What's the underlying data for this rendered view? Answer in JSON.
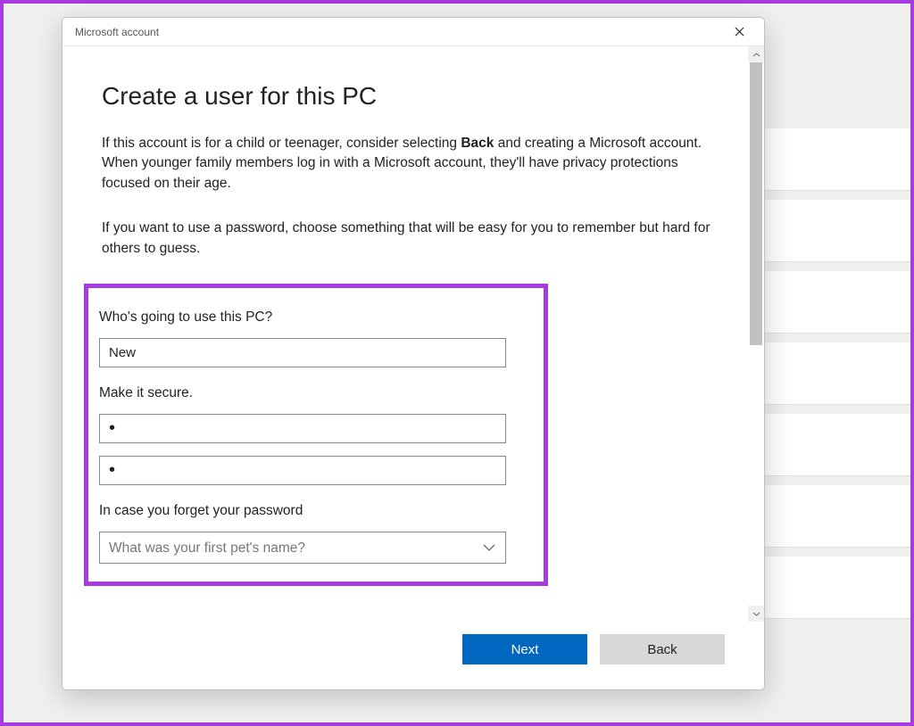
{
  "window": {
    "title": "Microsoft account"
  },
  "page": {
    "heading": "Create a user for this PC",
    "para1_pre": "If this account is for a child or teenager, consider selecting ",
    "para1_bold": "Back",
    "para1_post": " and creating a Microsoft account. When younger family members log in with a Microsoft account, they'll have privacy protections focused on their age.",
    "para2": "If you want to use a password, choose something that will be easy for you to remember but hard for others to guess."
  },
  "form": {
    "who_label": "Who's going to use this PC?",
    "username_value": "New",
    "secure_label": "Make it secure.",
    "password_value": "•",
    "password_confirm_value": "•",
    "forgot_label": "In case you forget your password",
    "security_question_placeholder": "What was your first pet's name?"
  },
  "buttons": {
    "next": "Next",
    "back": "Back"
  },
  "colors": {
    "accent_purple": "#a63be0",
    "primary_blue": "#0067c0"
  }
}
